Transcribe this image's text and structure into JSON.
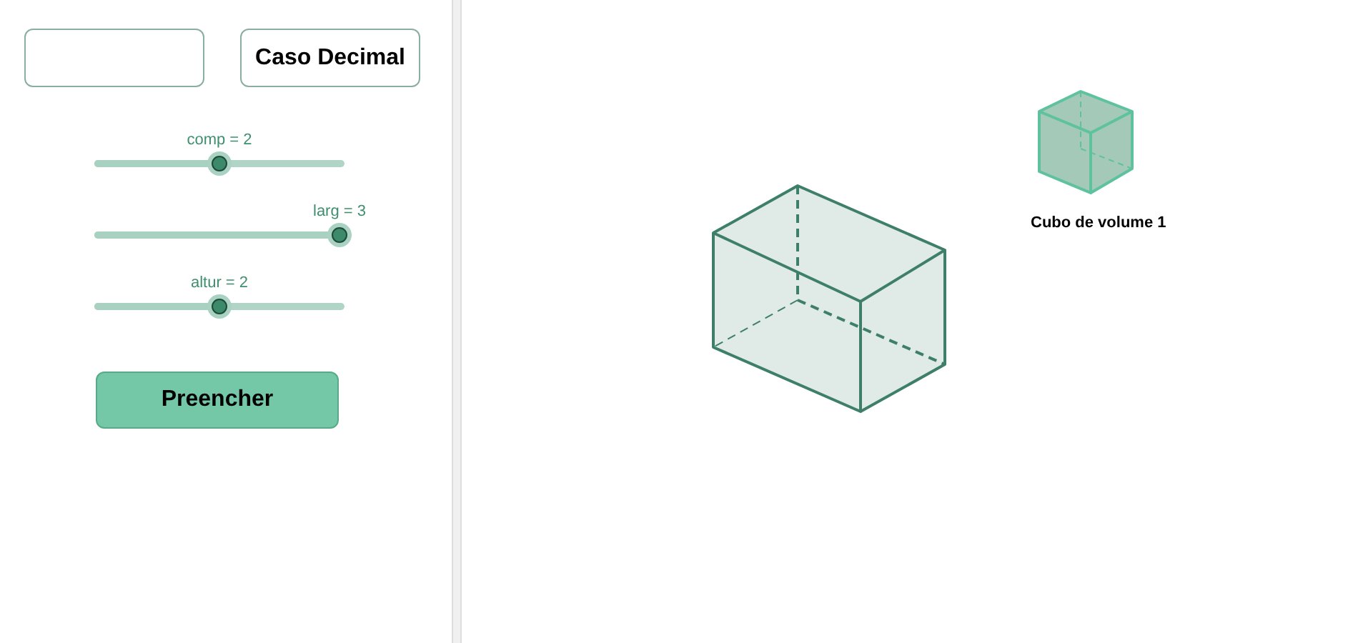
{
  "controls": {
    "decimal_button": "Caso Decimal",
    "sliders": [
      {
        "label": "comp = 2",
        "level": 0.5
      },
      {
        "label": "larg = 3",
        "level": 0.98
      },
      {
        "label": "altur = 2",
        "level": 0.5
      }
    ],
    "fill_button": "Preencher"
  },
  "canvas": {
    "unit_cube_caption": "Cubo de volume 1"
  }
}
